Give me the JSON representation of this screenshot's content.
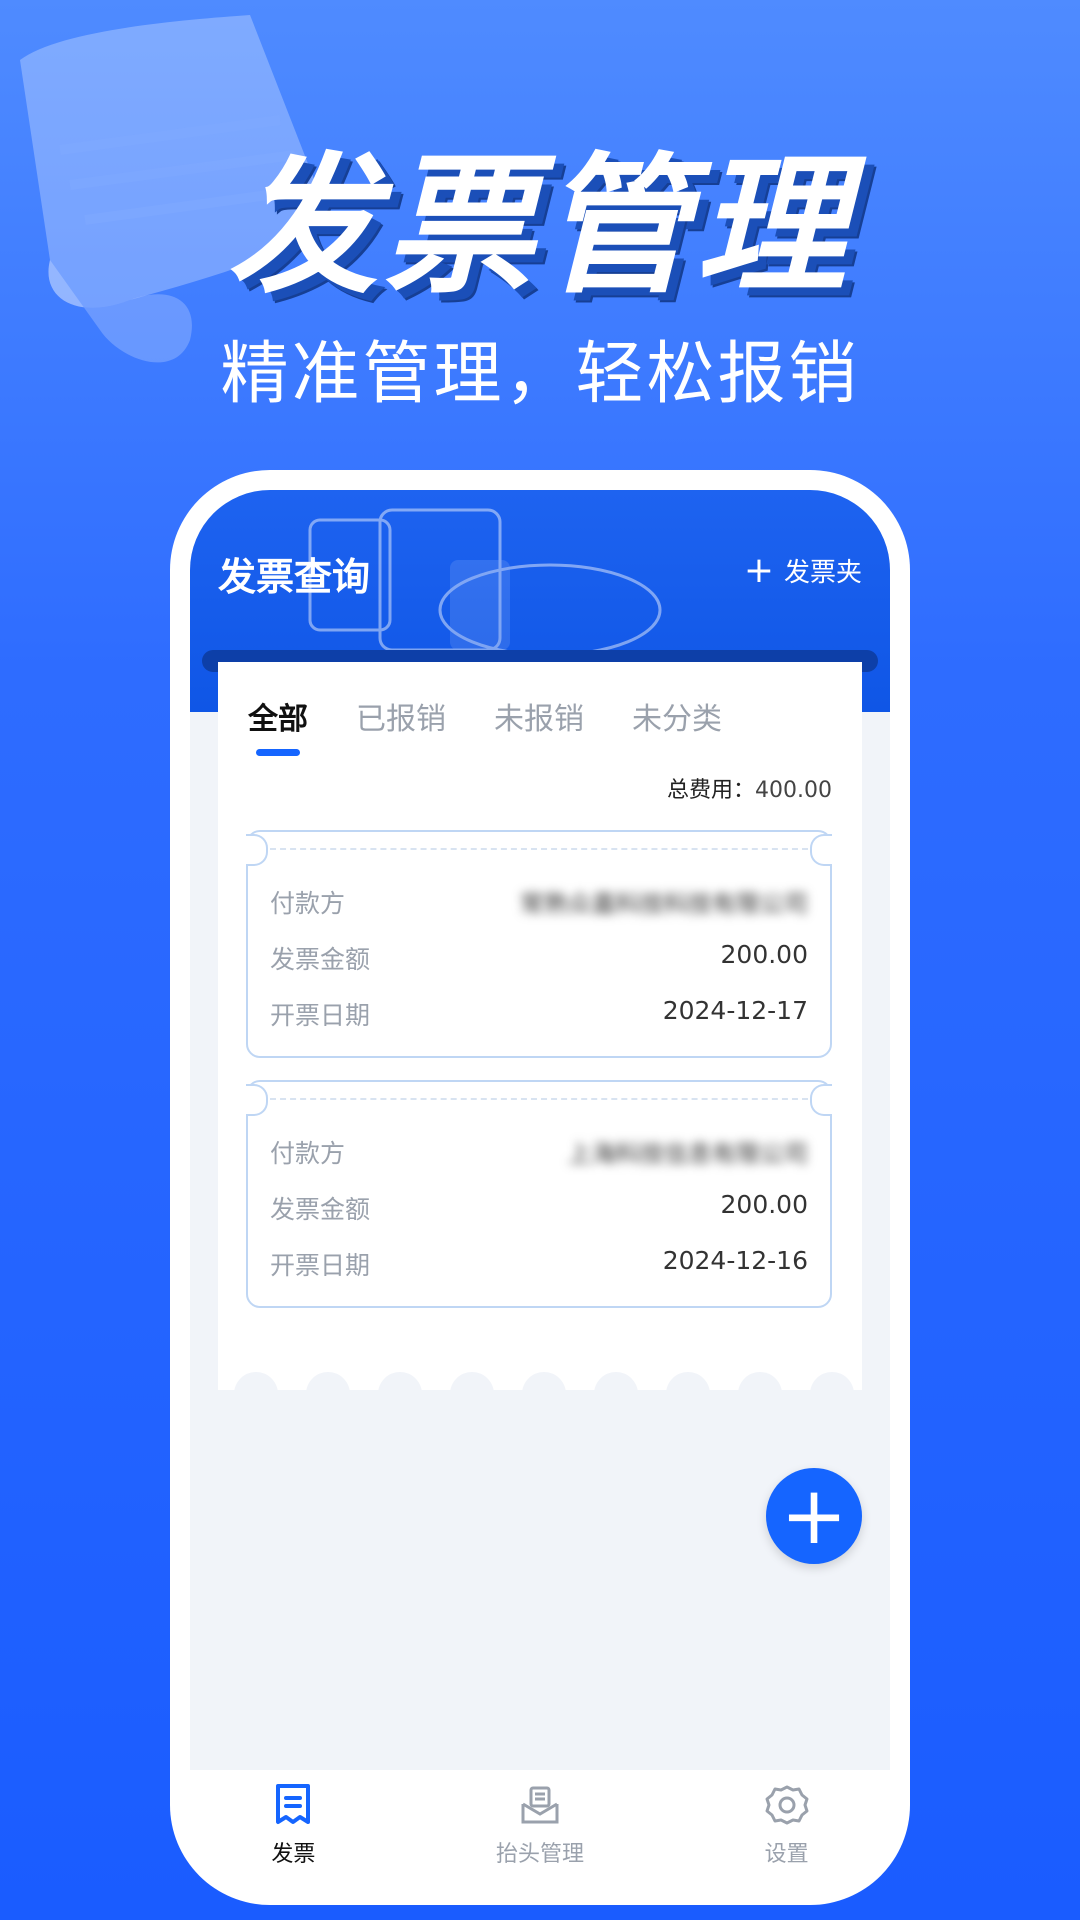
{
  "hero": {
    "title": "发票管理",
    "subtitle": "精准管理，轻松报销"
  },
  "app": {
    "title": "发票查询",
    "folder_button_icon": "plus-icon",
    "folder_button_label": "发票夹",
    "tabs": [
      {
        "label": "全部",
        "active": true
      },
      {
        "label": "已报销",
        "active": false
      },
      {
        "label": "未报销",
        "active": false
      },
      {
        "label": "未分类",
        "active": false
      }
    ],
    "total": {
      "label": "总费用：",
      "value": "400.00"
    },
    "invoices": [
      {
        "payer_label": "付款方",
        "payer_value": "常熟众嘉科技科技有限公司",
        "amount_label": "发票金额",
        "amount_value": "200.00",
        "date_label": "开票日期",
        "date_value": "2024-12-17"
      },
      {
        "payer_label": "付款方",
        "payer_value": "上海科技信息有限公司",
        "amount_label": "发票金额",
        "amount_value": "200.00",
        "date_label": "开票日期",
        "date_value": "2024-12-16"
      }
    ],
    "fab_icon": "plus-icon"
  },
  "nav": {
    "items": [
      {
        "label": "发票",
        "icon": "invoice-icon",
        "active": true
      },
      {
        "label": "抬头管理",
        "icon": "inbox-icon",
        "active": false
      },
      {
        "label": "设置",
        "icon": "gear-icon",
        "active": false
      }
    ]
  },
  "colors": {
    "accent": "#1565ff",
    "header": "#1e63f0",
    "background_top": "#4f8bff",
    "background_bottom": "#1a5cff"
  }
}
